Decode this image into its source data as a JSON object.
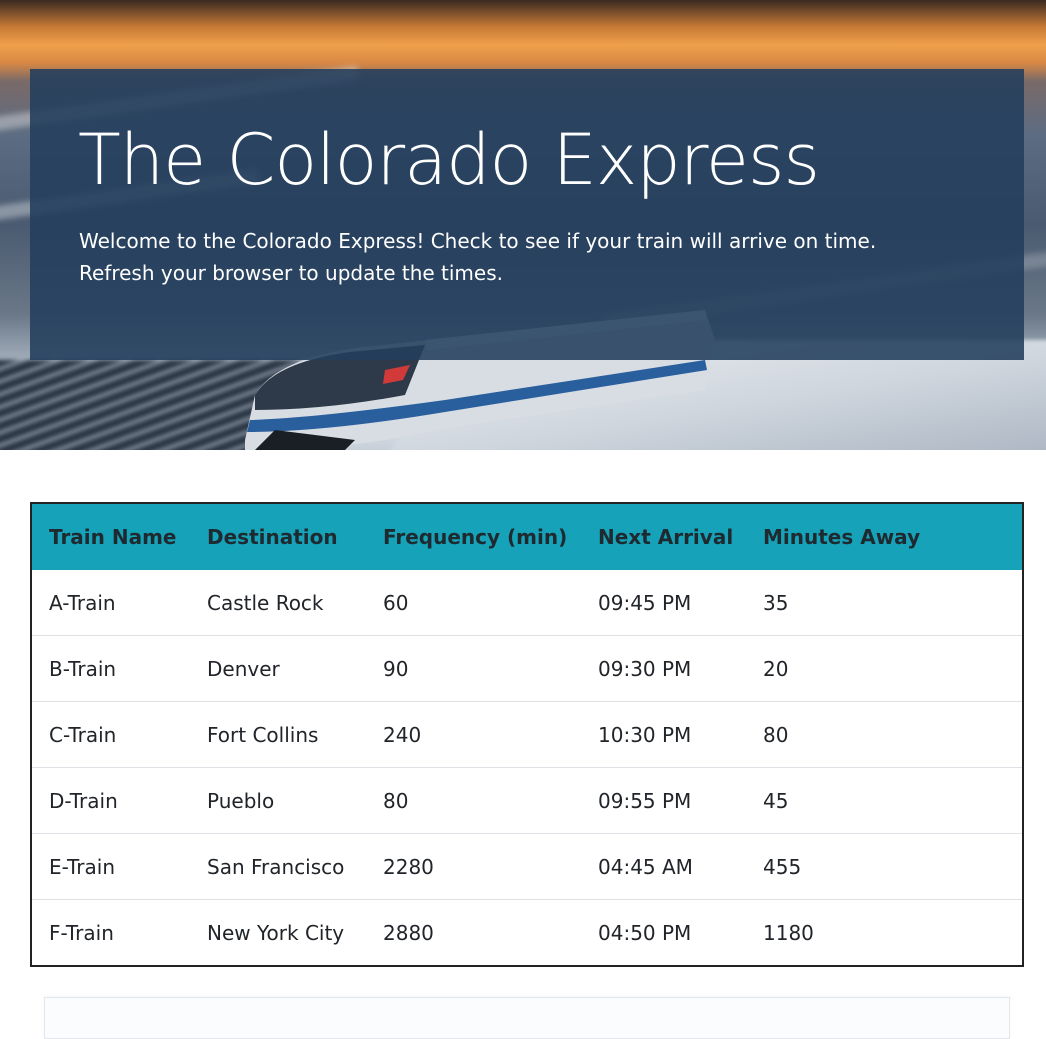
{
  "header": {
    "title": "The Colorado Express",
    "subtitle": "Welcome to the Colorado Express! Check to see if your train will arrive on time. Refresh your browser to update the times."
  },
  "table": {
    "columns": [
      "Train Name",
      "Destination",
      "Frequency (min)",
      "Next Arrival",
      "Minutes Away"
    ],
    "rows": [
      [
        "A-Train",
        "Castle Rock",
        "60",
        "09:45 PM",
        "35"
      ],
      [
        "B-Train",
        "Denver",
        "90",
        "09:30 PM",
        "20"
      ],
      [
        "C-Train",
        "Fort Collins",
        "240",
        "10:30 PM",
        "80"
      ],
      [
        "D-Train",
        "Pueblo",
        "80",
        "09:55 PM",
        "45"
      ],
      [
        "E-Train",
        "San Francisco",
        "2280",
        "04:45 AM",
        "455"
      ],
      [
        "F-Train",
        "New York City",
        "2880",
        "04:50 PM",
        "1180"
      ]
    ]
  },
  "colors": {
    "table_header": "#16a2b8",
    "jumbotron": "#223e5c"
  }
}
